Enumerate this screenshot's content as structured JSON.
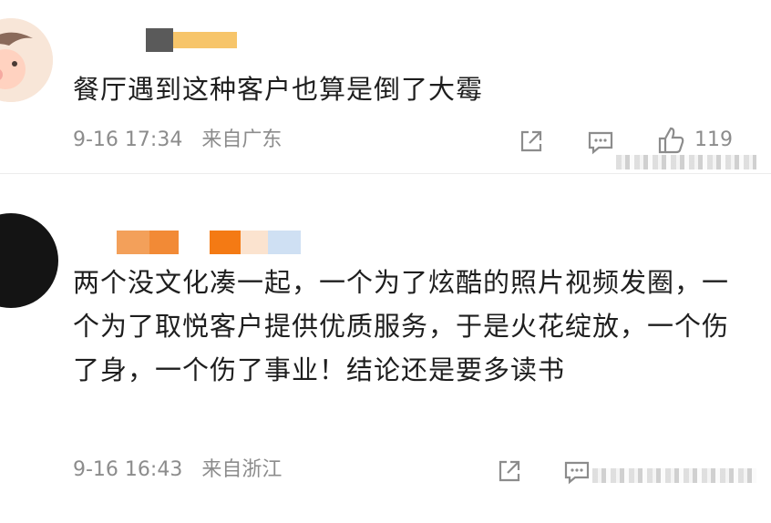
{
  "comments": [
    {
      "text": "餐厅遇到这种客户也算是倒了大霉",
      "date": "9-16 17:34",
      "location": "来自广东",
      "likes": "119"
    },
    {
      "text": "两个没文化凑一起，一个为了炫酷的照片视频发圈，一个为了取悦客户提供优质服务，于是火花绽放，一个伤了身，一个伤了事业！结论还是要多读书",
      "date": "9-16 16:43",
      "location": "来自浙江"
    }
  ],
  "icons": {
    "share": "share-icon",
    "comment": "comment-icon",
    "like": "thumbs-up-icon"
  },
  "colors": {
    "text": "#1e1e1e",
    "meta": "#8c8c8c",
    "divider": "#ececec"
  }
}
